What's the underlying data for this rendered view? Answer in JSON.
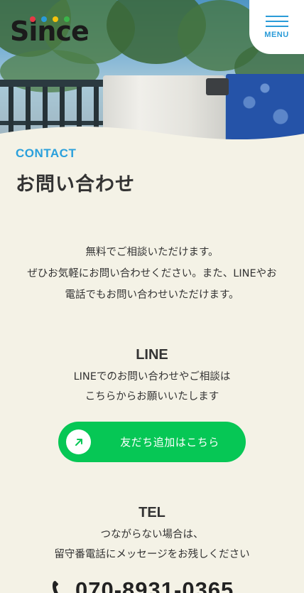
{
  "header": {
    "logo_text": "Since",
    "logo_dot_colors": [
      "#e63946",
      "#2a9bd8",
      "#f4c20d",
      "#3bb44a"
    ],
    "menu_label": "MENU",
    "accent_color": "#2a9bd8"
  },
  "page": {
    "eyebrow": "CONTACT",
    "title": "お問い合わせ"
  },
  "intro": {
    "lines": [
      "無料でご相談いただけます。",
      "ぜひお気軽にお問い合わせください。また、LINEやお",
      "電話でもお問い合わせいただけます。"
    ]
  },
  "line_section": {
    "heading": "LINE",
    "lines": [
      "LINEでのお問い合わせやご相談は",
      "こちらからお願いいたします"
    ],
    "button_label": "友だち追加はこちら",
    "button_icon": "arrow-up-right-icon",
    "button_color": "#06c755"
  },
  "tel_section": {
    "heading": "TEL",
    "lines": [
      "つながらない場合は、",
      "留守番電話にメッセージをお残しください"
    ],
    "phone_icon": "phone-icon",
    "number": "070-8931-0365"
  }
}
